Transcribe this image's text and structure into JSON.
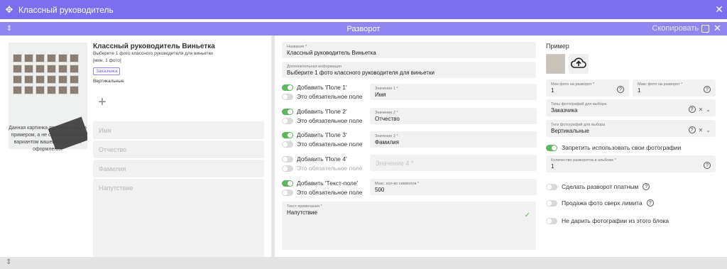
{
  "window": {
    "title": "Классный руководитель"
  },
  "spread": {
    "title": "Разворот",
    "copy_label": "Скопировать"
  },
  "left": {
    "heading": "Классный руководитель Виньетка",
    "subtitle": "Выберите 1 фото классного руководителя для виньетки",
    "min_note": "[мин. 1 фото]",
    "badge_customer": "Заказчика",
    "badge_orientation": "Вертикальные",
    "disclaimer": "Данная картинка является только примером, а не окончательным вариантом вашего дизайна и оформления",
    "fields": [
      "Имя",
      "Отчество",
      "Фамилия",
      "Напутствие"
    ]
  },
  "middle": {
    "name": {
      "label": "Название *",
      "value": "Классный руководитель Виньетка"
    },
    "info": {
      "label": "Дополнительная информация",
      "value": "Выберите 1 фото классного руководителя для виньетки"
    },
    "fields": [
      {
        "add": "Добавить 'Поле 1'",
        "required": "Это обязательное поле",
        "sub_label": "Значение 1 *",
        "sub_value": "Имя",
        "on": true
      },
      {
        "add": "Добавить 'Поле 2'",
        "required": "Это обязательное поле",
        "sub_label": "Значение 2 *",
        "sub_value": "Отчество",
        "on": true
      },
      {
        "add": "Добавить 'Поле 3'",
        "required": "Это обязательное поле",
        "sub_label": "Значение 3 *",
        "sub_value": "Фамилия",
        "on": true
      },
      {
        "add": "Добавить 'Поле 4'",
        "required": "Это обязательное поле",
        "sub_placeholder": "Значение 4 *",
        "on": false
      }
    ],
    "textfield": {
      "add": "Добавить 'Текст-поле'",
      "required": "Это обязательное поле",
      "sub_label": "Макс. кол-во символов *",
      "sub_value": "500"
    },
    "note": {
      "label": "Текст примечания *",
      "value": "Напутствие"
    }
  },
  "right": {
    "title": "Пример",
    "min_photos": {
      "label": "Мин фото на разворот *",
      "value": "1"
    },
    "max_photos": {
      "label": "Макс фото на разворот *",
      "value": "1"
    },
    "photo_types": {
      "label": "Типы фотографий для выбора",
      "value": "Заказчика"
    },
    "photo_tags": {
      "label": "Теги фотографий для выбора",
      "value": "Вертикальные"
    },
    "forbid_own": "Запретить использовать свои фотографии",
    "spreads_count": {
      "label": "Количество разворотов в альбоме *",
      "value": "1"
    },
    "paid": "Сделать разворот платным",
    "sell_over": "Продажа фото сверх лимита",
    "no_gift": "Не дарить фотографии из этого блока"
  },
  "icons": {
    "help": "?",
    "clear": "✕",
    "chevron": "⌄",
    "close": "✕",
    "move": "✥",
    "drag": "⇕",
    "plus": "+"
  },
  "colors": {
    "accent": "#7c6fef",
    "accent_light": "#8f86f2",
    "toggle_on": "#5cb85c"
  }
}
